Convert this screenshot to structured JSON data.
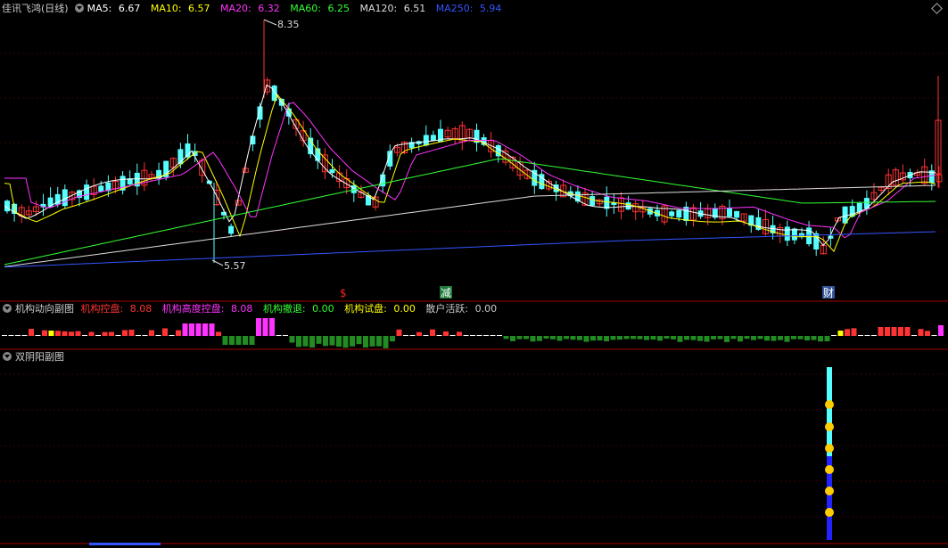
{
  "main_panel": {
    "title": "佳讯飞鸿(日线)",
    "ma_items": [
      {
        "label": "MA5:",
        "value": "6.67",
        "color": "#ffffff"
      },
      {
        "label": "MA10:",
        "value": "6.57",
        "color": "#ffff00"
      },
      {
        "label": "MA20:",
        "value": "6.32",
        "color": "#ff33ff"
      },
      {
        "label": "MA60:",
        "value": "6.25",
        "color": "#33ff33"
      },
      {
        "label": "MA120:",
        "value": "6.51",
        "color": "#dddddd"
      },
      {
        "label": "MA250:",
        "value": "5.94",
        "color": "#3355ff"
      }
    ],
    "high_label": "8.35",
    "low_label": "5.57",
    "markers": [
      {
        "text": "$",
        "color": "#ff2222"
      },
      {
        "text": "减",
        "color": "#ffffff",
        "bg": "#1f7a3a"
      },
      {
        "text": "财",
        "color": "#ffffff",
        "bg": "#335599"
      }
    ]
  },
  "sub_panel_1": {
    "title": "机构动向副图",
    "items": [
      {
        "label": "机构控盘:",
        "value": "8.08",
        "color": "#ff3333"
      },
      {
        "label": "机构高度控盘:",
        "value": "8.08",
        "color": "#ff33ff"
      },
      {
        "label": "机构撤退:",
        "value": "0.00",
        "color": "#33ff33"
      },
      {
        "label": "机构试盘:",
        "value": "0.00",
        "color": "#ffff00"
      },
      {
        "label": "散户活跃:",
        "value": "0.00",
        "color": "#cccccc"
      }
    ]
  },
  "sub_panel_2": {
    "title": "双阴阳副图"
  },
  "colors": {
    "up": "#ff3333",
    "down": "#55ffff",
    "axis_grid": "#550000",
    "border": "#aa0000"
  }
}
